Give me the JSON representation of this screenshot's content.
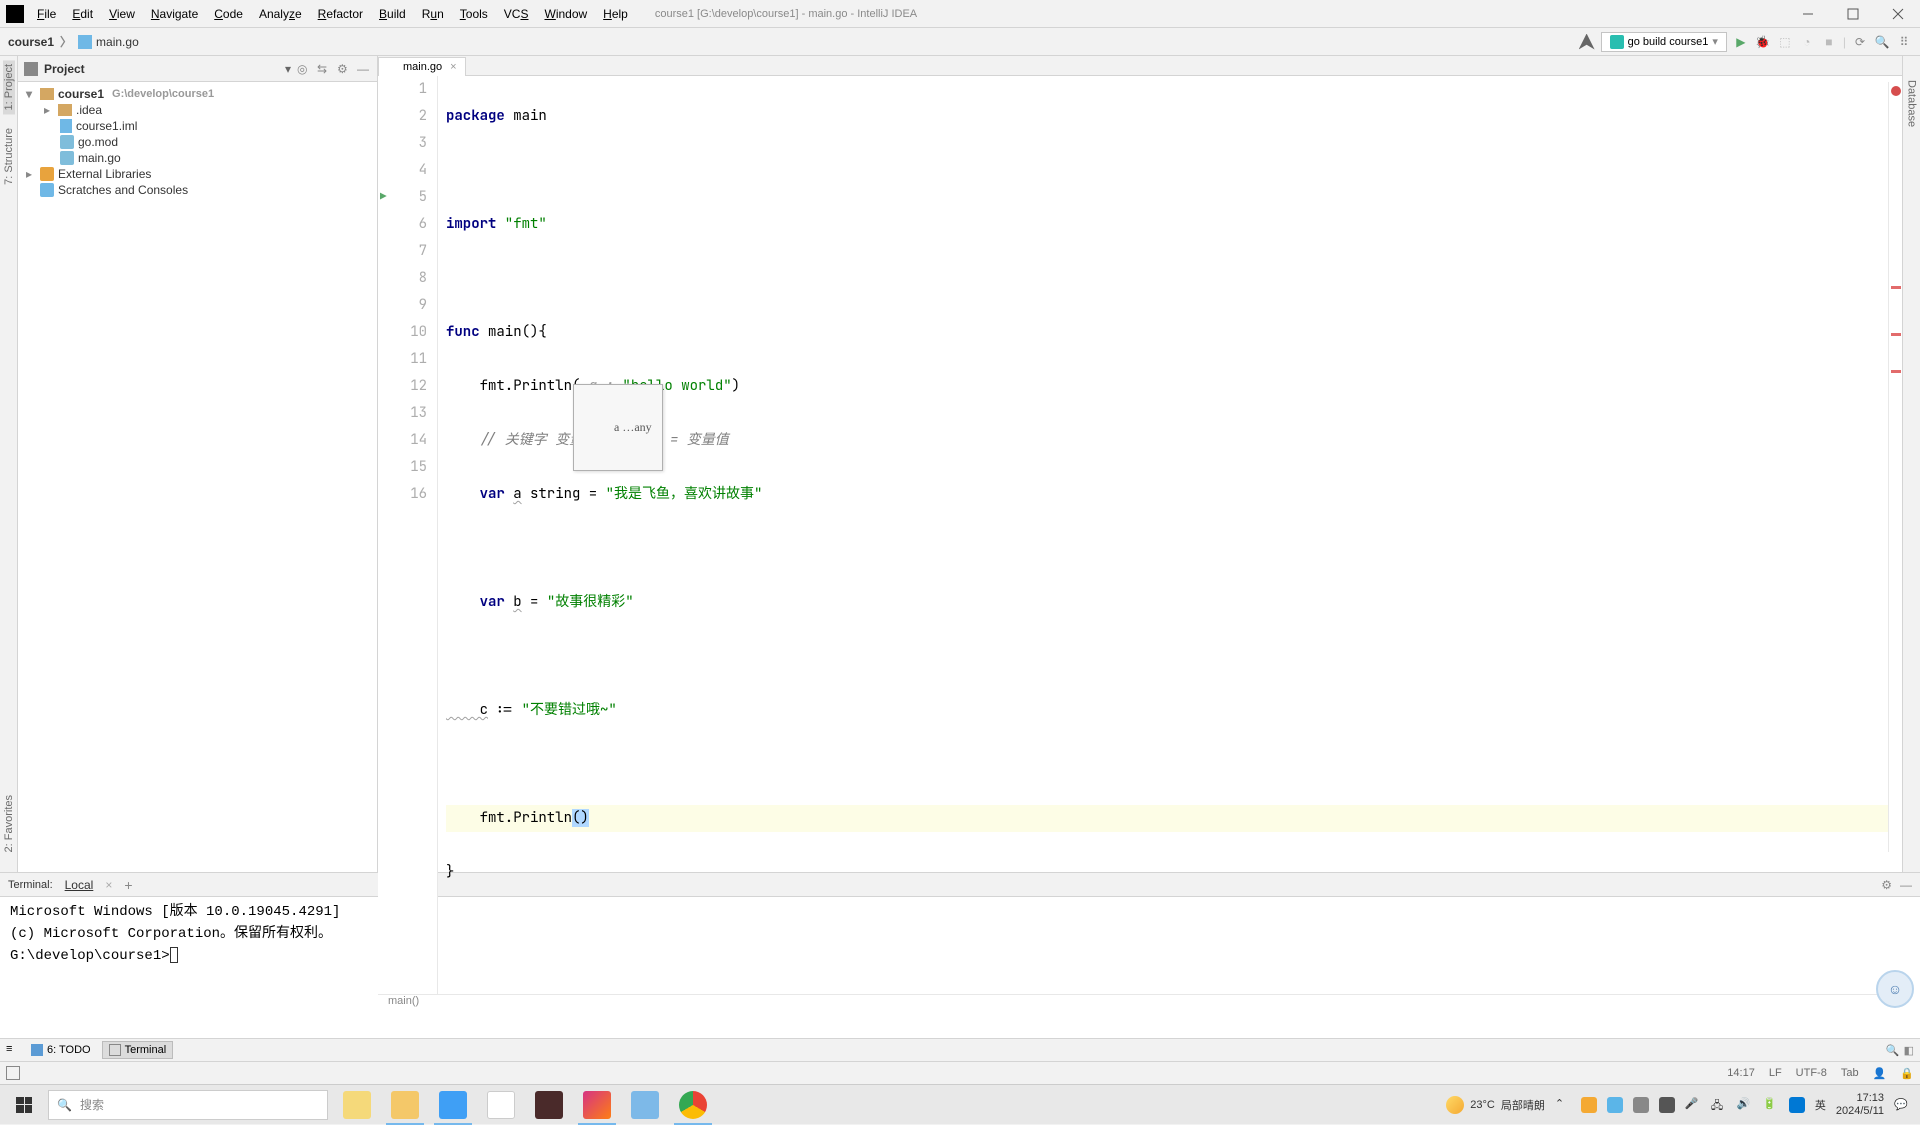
{
  "titlebar": {
    "menu": [
      "File",
      "Edit",
      "View",
      "Navigate",
      "Code",
      "Analyze",
      "Refactor",
      "Build",
      "Run",
      "Tools",
      "VCS",
      "Window",
      "Help"
    ],
    "title": "course1 [G:\\develop\\course1] - main.go - IntelliJ IDEA"
  },
  "breadcrumb": {
    "project": "course1",
    "file": "main.go",
    "run_config": "go build course1"
  },
  "project_panel": {
    "title": "Project",
    "root": "course1",
    "root_path": "G:\\develop\\course1",
    "items": [
      ".idea",
      "course1.iml",
      "go.mod",
      "main.go"
    ],
    "external": "External Libraries",
    "scratches": "Scratches and Consoles"
  },
  "left_stripe": {
    "project": "1: Project",
    "structure": "7: Structure",
    "favorites": "2: Favorites"
  },
  "right_stripe": {
    "database": "Database"
  },
  "editor": {
    "tab": "main.go",
    "lines": {
      "l1_kw": "package",
      "l1_name": " main",
      "l3_kw": "import",
      "l3_str": " \"fmt\"",
      "l5_kw": "func ",
      "l5_name": "main(){",
      "l6_pre": "    fmt.Println( ",
      "l6_hint": "a…: ",
      "l6_str": "\"hello world\"",
      "l6_post": ")",
      "l7_cmt": "    // 关键字 变量名 变量类型 = 变量值",
      "l8_kw": "    var ",
      "l8_var": "a",
      "l8_type": " string = ",
      "l8_str": "\"我是飞鱼，喜欢讲故事\"",
      "l10_kw": "    var ",
      "l10_var": "b",
      "l10_eq": " = ",
      "l10_str": "\"故事很精彩\"",
      "l12_var": "    c",
      "l12_op": " := ",
      "l12_str": "\"不要错过哦~\"",
      "l14_pre": "    fmt.Println",
      "l14_p1": "(",
      "l14_p2": ")",
      "l15": "}",
      "l16": ""
    },
    "line_numbers": [
      "1",
      "2",
      "3",
      "4",
      "5",
      "6",
      "7",
      "8",
      "9",
      "10",
      "11",
      "12",
      "13",
      "14",
      "15",
      "16"
    ],
    "hint_popup": "a …any",
    "breadcrumb_bottom": "main()"
  },
  "terminal": {
    "title": "Terminal:",
    "tab": "Local",
    "lines": [
      "Microsoft Windows [版本 10.0.19045.4291]",
      "(c) Microsoft Corporation。保留所有权利。",
      "G:\\develop\\course1>"
    ]
  },
  "tool_windows": {
    "todo": "6: TODO",
    "terminal": "Terminal"
  },
  "status": {
    "cursor": "14:17",
    "line_sep": "LF",
    "encoding": "UTF-8",
    "indent": "Tab"
  },
  "taskbar": {
    "search_placeholder": "搜索",
    "weather_temp": "23°C",
    "weather_desc": "局部晴朗",
    "time": "17:13",
    "date": "2024/5/11"
  }
}
